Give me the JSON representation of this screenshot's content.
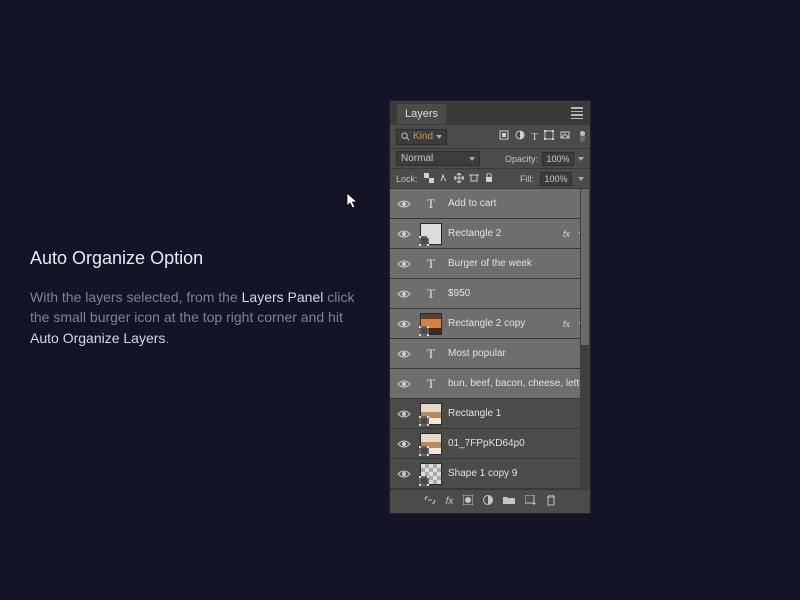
{
  "instruction": {
    "title": "Auto Organize Option",
    "line1_pre": "With the layers selected, from the ",
    "line1_hl": "Layers Panel",
    "line2": "click the small burger icon at the top right corner and hit ",
    "line2_hl": "Auto Organize Layers",
    "line2_end": "."
  },
  "panel": {
    "tab": "Layers",
    "kind_label": "Kind",
    "blend_mode": "Normal",
    "opacity_label": "Opacity:",
    "opacity_value": "100%",
    "lock_label": "Lock:",
    "fill_label": "Fill:",
    "fill_value": "100%",
    "layers": [
      {
        "name": "Add to cart",
        "type": "text",
        "selected": true,
        "fx": false
      },
      {
        "name": "Rectangle 2",
        "type": "shape",
        "selected": true,
        "fx": true
      },
      {
        "name": "Burger of the week",
        "type": "text",
        "selected": true,
        "fx": false
      },
      {
        "name": "$950",
        "type": "text",
        "selected": true,
        "fx": false
      },
      {
        "name": "Rectangle 2 copy",
        "type": "img2",
        "selected": true,
        "fx": true
      },
      {
        "name": "Most popular",
        "type": "text",
        "selected": true,
        "fx": false
      },
      {
        "name": "bun, beef, bacon, cheese, lettuc...",
        "type": "text",
        "selected": true,
        "fx": false
      },
      {
        "name": "Rectangle 1",
        "type": "img1",
        "selected": false,
        "fx": false
      },
      {
        "name": "01_7FPpKD64p0",
        "type": "img1",
        "selected": false,
        "fx": false
      },
      {
        "name": "Shape 1 copy 9",
        "type": "checker",
        "selected": false,
        "fx": false
      }
    ]
  }
}
